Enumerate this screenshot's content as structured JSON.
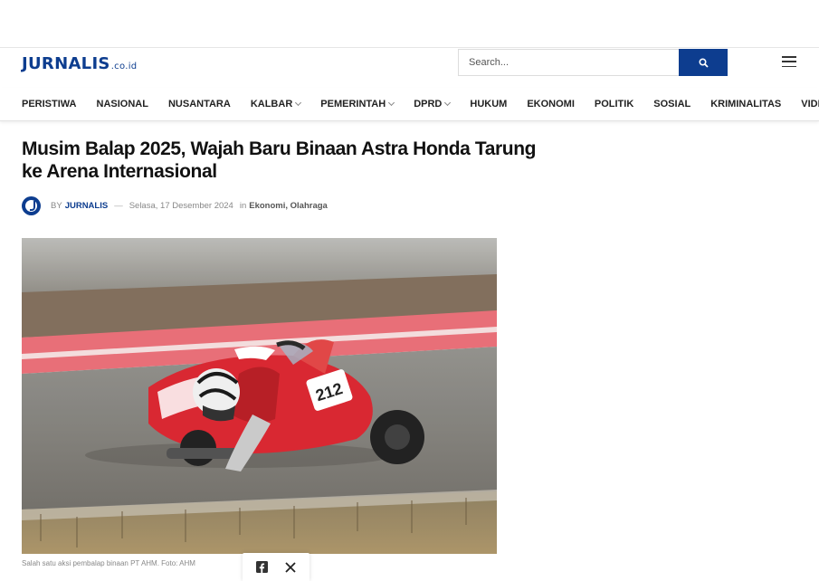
{
  "header": {
    "logo_text": "JURNALIS",
    "logo_tld": ".co.id",
    "search_placeholder": "Search...",
    "search_icon": "search-icon",
    "menu_icon": "hamburger-icon"
  },
  "nav": {
    "items": [
      {
        "label": "PERISTIWA",
        "has_dropdown": false
      },
      {
        "label": "NASIONAL",
        "has_dropdown": false
      },
      {
        "label": "NUSANTARA",
        "has_dropdown": false
      },
      {
        "label": "KALBAR",
        "has_dropdown": true
      },
      {
        "label": "PEMERINTAH",
        "has_dropdown": true
      },
      {
        "label": "DPRD",
        "has_dropdown": true
      },
      {
        "label": "HUKUM",
        "has_dropdown": false
      },
      {
        "label": "EKONOMI",
        "has_dropdown": false
      },
      {
        "label": "POLITIK",
        "has_dropdown": false
      },
      {
        "label": "SOSIAL",
        "has_dropdown": false
      },
      {
        "label": "KRIMINALITAS",
        "has_dropdown": false
      },
      {
        "label": "VIDEO",
        "has_dropdown": false
      }
    ]
  },
  "article": {
    "title": "Musim Balap 2025, Wajah Baru Binaan Astra Honda Tarung ke Arena Internasional",
    "by_label": "BY",
    "author": "JURNALIS",
    "separator": "—",
    "date": "Selasa, 17 Desember 2024",
    "in_label": "in",
    "category_1": "Ekonomi",
    "category_sep": ",",
    "category_2": "Olahraga",
    "image_caption": "Salah satu aksi pembalap binaan PT AHM. Foto: AHM",
    "bike_number": "212"
  },
  "share": {
    "facebook_icon": "facebook-icon",
    "x_icon": "x-icon"
  },
  "colors": {
    "brand": "#0d3d8f",
    "bike_red": "#d8202a"
  }
}
